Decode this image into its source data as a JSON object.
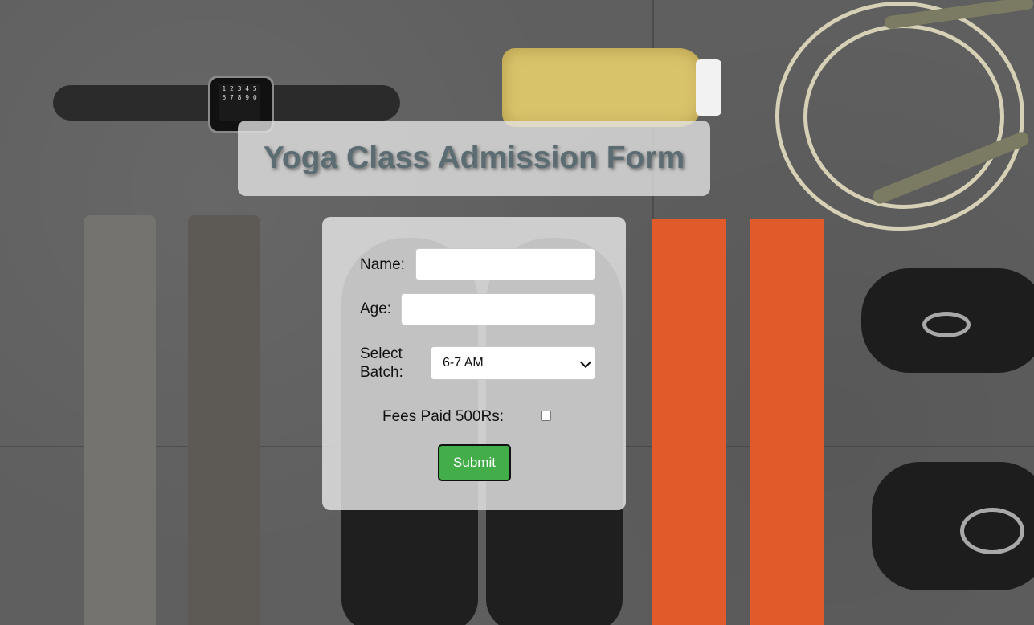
{
  "page": {
    "title": "Yoga Class Admission Form"
  },
  "form": {
    "name_label": "Name:",
    "name_value": "",
    "age_label": "Age:",
    "age_value": "",
    "batch_label_line1": "Select",
    "batch_label_line2": "Batch:",
    "batch_selected": "6-7 AM",
    "fees_label": "Fees Paid 500Rs:",
    "fees_checked": false,
    "submit_label": "Submit"
  },
  "background": {
    "watch_digits": "1 2 3 4 5 6 7 8 9 0"
  },
  "colors": {
    "title_text": "#5b6c72",
    "submit_bg": "#43ad4a",
    "panel_bg": "#e6e6e6"
  }
}
